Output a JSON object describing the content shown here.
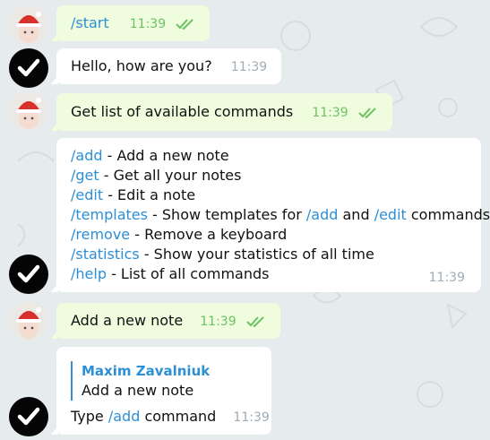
{
  "messages": [
    {
      "text": "/start",
      "time": "11:39"
    },
    {
      "text": "Hello, how are you?",
      "time": "11:39"
    },
    {
      "text": "Get list of available commands",
      "time": "11:39"
    },
    {
      "commands": [
        {
          "cmd": "/add",
          "desc": " - Add a new note"
        },
        {
          "cmd": "/get",
          "desc": " - Get all your notes"
        },
        {
          "cmd": "/edit",
          "desc": " - Edit a note"
        },
        {
          "cmd": "/templates",
          "desc": " - Show templates for ",
          "cmd2": "/add",
          "mid": " and ",
          "cmd3": "/edit",
          "tail": " commands"
        },
        {
          "cmd": "/remove",
          "desc": " - Remove a keyboard"
        },
        {
          "cmd": "/statistics",
          "desc": " - Show your statistics of all time"
        },
        {
          "cmd": "/help",
          "desc": " - List of all commands"
        }
      ],
      "time": "11:39"
    },
    {
      "text": "Add a new note",
      "time": "11:39"
    },
    {
      "reply_name": "Maxim Zavalniuk",
      "reply_text": "Add a new note",
      "pre": "Type ",
      "cmd": "/add",
      "post": " command",
      "time": "11:39"
    }
  ],
  "colors": {
    "accent": "#2d8fd5",
    "outgoing": "#effdde",
    "incoming": "#ffffff",
    "read_check": "#6cc264"
  },
  "icons": {
    "user_avatar": "santa-hat-avatar-icon",
    "bot_avatar": "checkmark-avatar-icon",
    "read_status": "double-check-icon"
  }
}
